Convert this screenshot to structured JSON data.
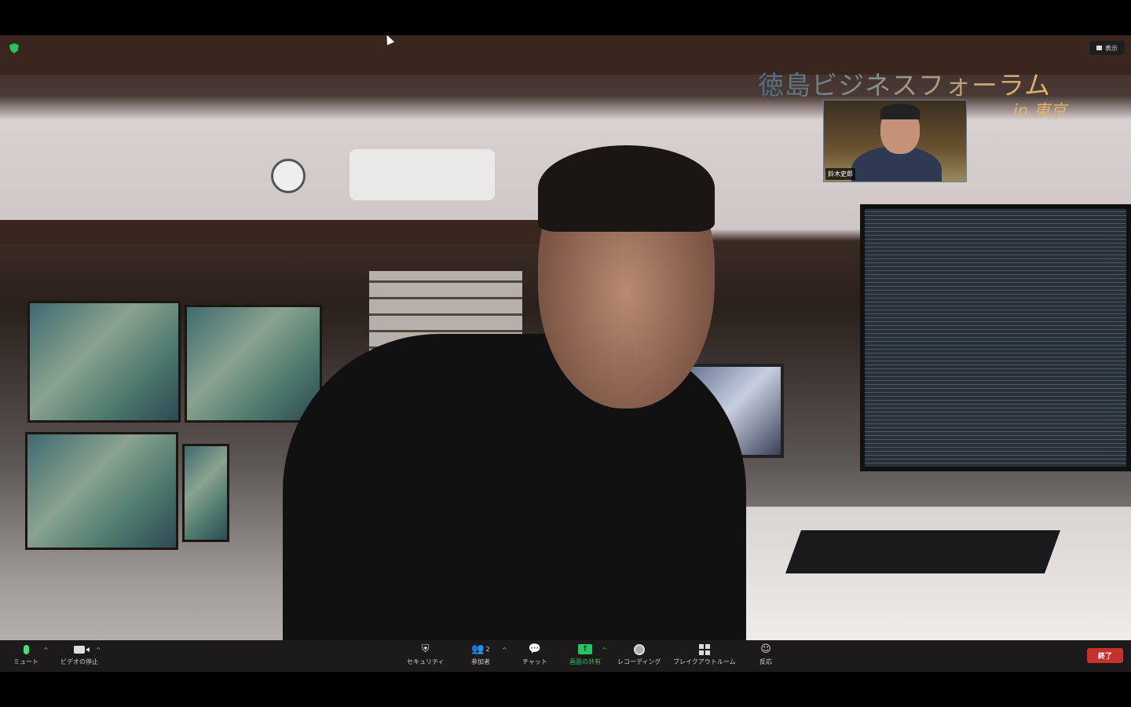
{
  "meeting": {
    "banner_title": "徳島ビジネスフォーラム",
    "banner_subtitle": "in 東京",
    "view_button": "表示",
    "thumbnail_name": "鈴木史郎"
  },
  "toolbar": {
    "mute": "ミュート",
    "stop_video": "ビデオの停止",
    "security": "セキュリティ",
    "participants": "参加者",
    "participant_count": "2",
    "chat": "チャット",
    "share_screen": "画面の共有",
    "recording": "レコーディング",
    "breakout_rooms": "ブレイクアウトルーム",
    "reactions": "反応",
    "end": "終了"
  },
  "colors": {
    "end": "#c8302d",
    "share": "#22c55e",
    "mic": "#4ade80"
  }
}
